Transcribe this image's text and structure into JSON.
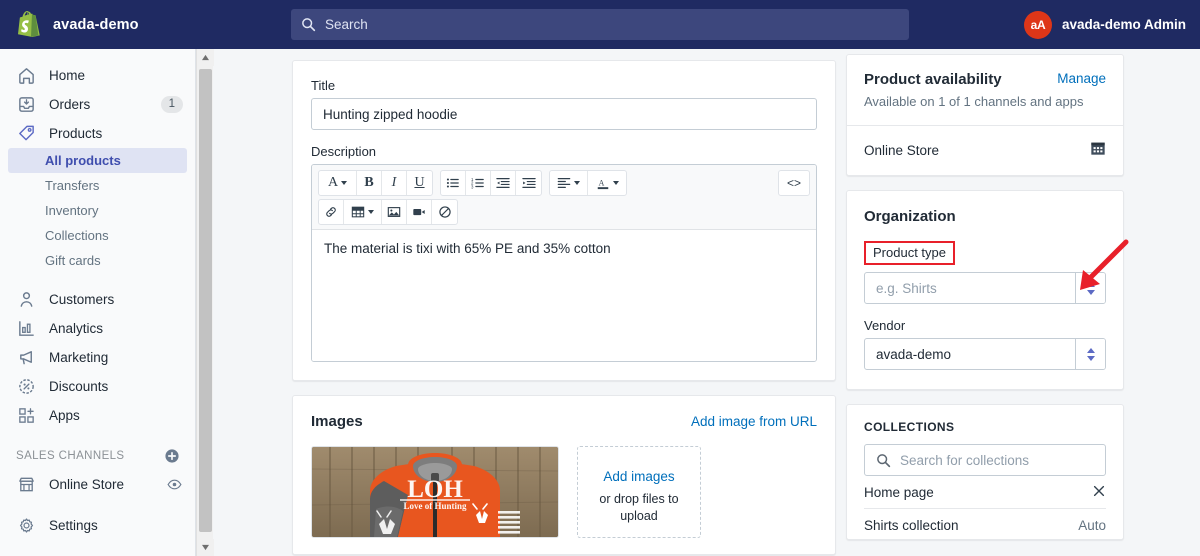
{
  "topbar": {
    "brand": "avada-demo",
    "logo_icon": "shopify-bag-icon",
    "search": {
      "icon": "search-icon",
      "placeholder": "Search",
      "value": ""
    },
    "user": {
      "initials": "aA",
      "name": "avada-demo Admin",
      "avatar_color": "#de3618"
    }
  },
  "sidebar": {
    "items": [
      {
        "label": "Home",
        "icon": "home-icon"
      },
      {
        "label": "Orders",
        "icon": "orders-inbox-icon",
        "badge": "1"
      },
      {
        "label": "Products",
        "icon": "products-tag-icon"
      }
    ],
    "product_subitems": [
      {
        "label": "All products",
        "active": true
      },
      {
        "label": "Transfers",
        "active": false
      },
      {
        "label": "Inventory",
        "active": false
      },
      {
        "label": "Collections",
        "active": false
      },
      {
        "label": "Gift cards",
        "active": false
      }
    ],
    "items2": [
      {
        "label": "Customers",
        "icon": "customer-person-icon"
      },
      {
        "label": "Analytics",
        "icon": "analytics-bar-chart-icon"
      },
      {
        "label": "Marketing",
        "icon": "marketing-megaphone-icon"
      },
      {
        "label": "Discounts",
        "icon": "discount-percent-icon"
      },
      {
        "label": "Apps",
        "icon": "apps-grid-plus-icon"
      }
    ],
    "sales_channels_header": "SALES CHANNELS",
    "sales_channels_add_icon": "plus-circle-icon",
    "online_store": {
      "label": "Online Store",
      "icon": "storefront-icon",
      "trailing_icon": "eye-icon"
    },
    "settings": {
      "label": "Settings",
      "icon": "gear-icon"
    },
    "scrollbar": {
      "up_icon": "caret-up-icon",
      "down_icon": "caret-down-icon"
    }
  },
  "product": {
    "title_label": "Title",
    "title_value": "Hunting zipped hoodie",
    "description_label": "Description",
    "description_body": "The material is tixi with 65% PE and 35% cotton",
    "toolbar": {
      "row1": [
        {
          "name": "font-family-button",
          "glyph": "A",
          "caret": true
        },
        {
          "name": "bold-button",
          "glyph": "B",
          "caret": false
        },
        {
          "name": "italic-button",
          "glyph": "I",
          "caret": false
        },
        {
          "name": "underline-button",
          "glyph": "U",
          "caret": false
        }
      ],
      "row1b": [
        {
          "name": "bulleted-list-button",
          "glyph": "list-bullet-icon"
        },
        {
          "name": "numbered-list-button",
          "glyph": "list-number-icon"
        },
        {
          "name": "outdent-button",
          "glyph": "outdent-icon"
        },
        {
          "name": "indent-button",
          "glyph": "indent-icon"
        }
      ],
      "row1c": [
        {
          "name": "align-button",
          "glyph": "align-left-icon",
          "caret": true
        },
        {
          "name": "text-color-button",
          "glyph": "text-color-icon",
          "caret": true
        }
      ],
      "code_button": {
        "name": "html-code-button",
        "glyph": "<>"
      },
      "row2": [
        {
          "name": "insert-link-button",
          "glyph": "link-icon"
        },
        {
          "name": "insert-table-button",
          "glyph": "table-icon",
          "caret": true
        },
        {
          "name": "insert-image-button",
          "glyph": "image-icon"
        },
        {
          "name": "insert-video-button",
          "glyph": "video-icon"
        },
        {
          "name": "clear-formatting-button",
          "glyph": "no-entry-icon"
        }
      ]
    },
    "images": {
      "title": "Images",
      "add_from_url": "Add image from URL",
      "thumbnail_alt": "Orange hunting zipped hoodie with LOH Love of Hunting logo",
      "dropzone_link": "Add images",
      "dropzone_text_1": "or drop files to",
      "dropzone_text_2": "upload"
    }
  },
  "availability": {
    "title": "Product availability",
    "manage_link": "Manage",
    "subtitle": "Available on 1 of 1 channels and apps",
    "channel": {
      "name": "Online Store",
      "icon": "calendar-icon"
    }
  },
  "organization": {
    "title": "Organization",
    "product_type": {
      "label": "Product type",
      "placeholder": "e.g. Shirts",
      "value": "",
      "highlighted": true,
      "stepper_icon": "stepper-updown-icon"
    },
    "vendor": {
      "label": "Vendor",
      "value": "avada-demo",
      "stepper_icon": "stepper-updown-icon"
    }
  },
  "collections": {
    "header": "COLLECTIONS",
    "search_icon": "search-icon",
    "search_placeholder": "Search for collections",
    "rows": [
      {
        "name": "Home page",
        "trailing": "",
        "trailing_icon": "close-x-icon"
      },
      {
        "name": "Shirts collection",
        "trailing": "Auto",
        "trailing_icon": ""
      }
    ]
  },
  "annotation": {
    "arrow_color": "#e8202a",
    "highlight_color": "#e8202a"
  }
}
